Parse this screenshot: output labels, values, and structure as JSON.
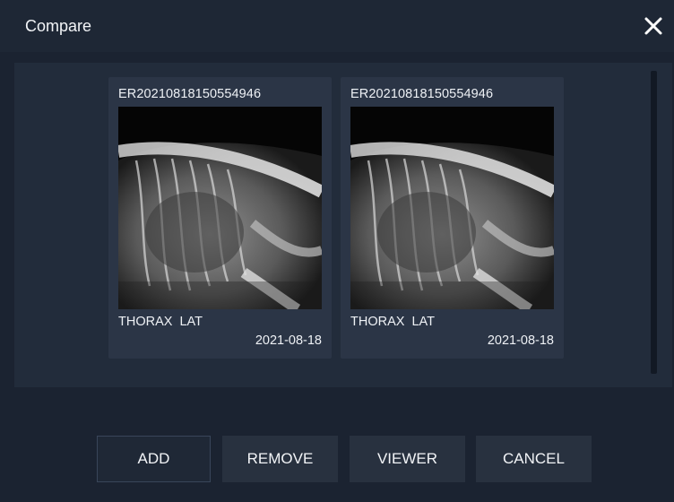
{
  "dialog": {
    "title": "Compare",
    "close_icon": "close-icon"
  },
  "studies": [
    {
      "id": "ER20210818150554946",
      "exam": "THORAX  LAT",
      "date": "2021-08-18"
    },
    {
      "id": "ER20210818150554946",
      "exam": "THORAX  LAT",
      "date": "2021-08-18"
    }
  ],
  "buttons": {
    "add": "ADD",
    "remove": "REMOVE",
    "viewer": "VIEWER",
    "cancel": "CANCEL"
  },
  "colors": {
    "background": "#1b2331",
    "panel": "#222c3b",
    "card": "#2b3546",
    "button": "#28313f"
  }
}
